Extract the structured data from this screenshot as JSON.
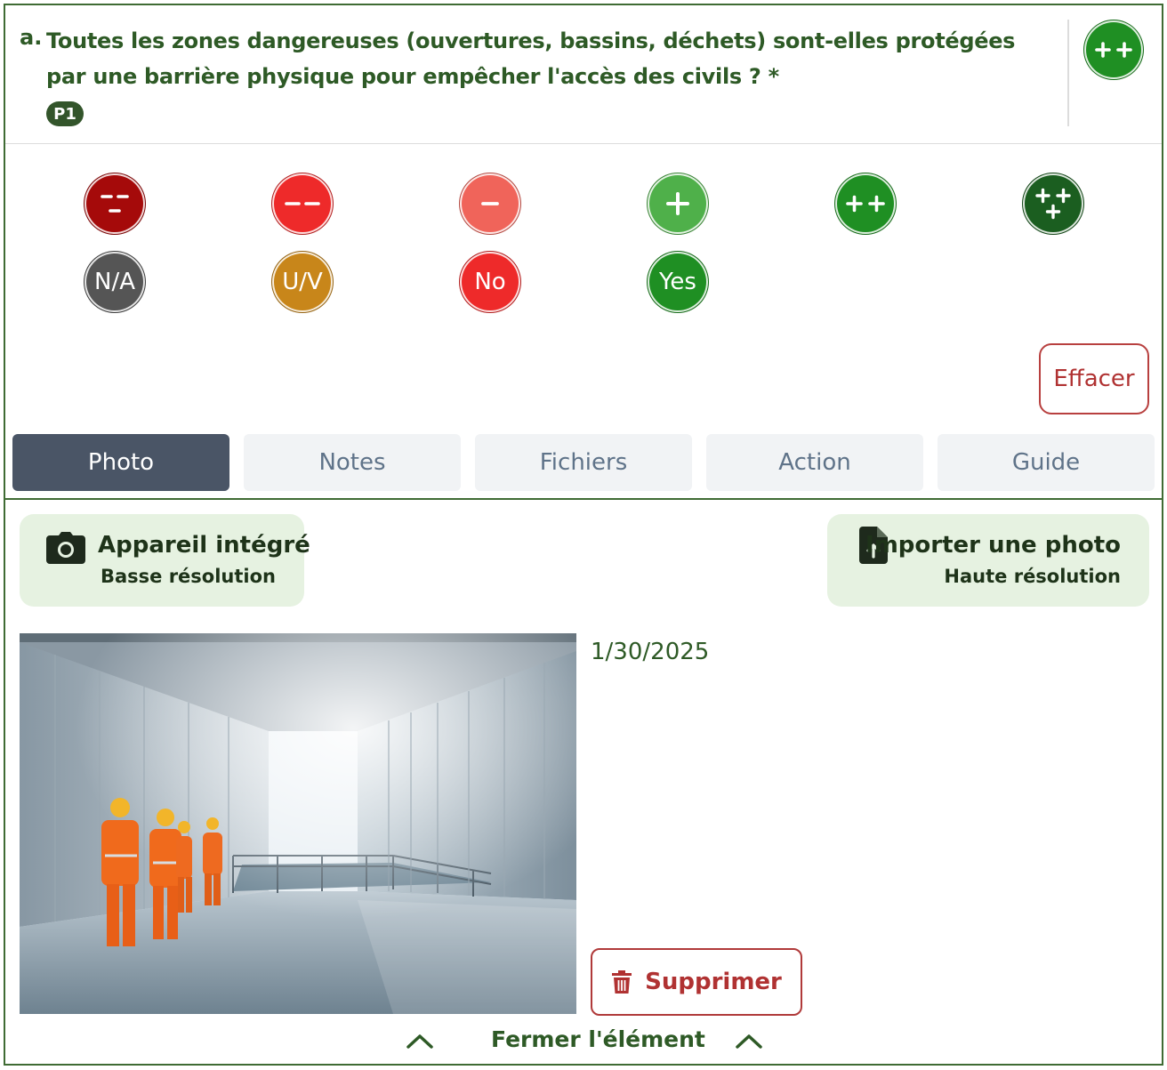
{
  "question": {
    "prefix": "a.",
    "text": "Toutes les zones dangereuses (ouvertures, bassins, déchets) sont-elles protégées par une barrière physique pour empêcher l'accès des civils ? *",
    "priority_badge": "P1",
    "selected_rating_label": "++"
  },
  "ratings": [
    {
      "label": "– – –",
      "color": "#a50a0a"
    },
    {
      "label": "– –",
      "color": "#ee2a2a"
    },
    {
      "label": "–",
      "color": "#f0645a"
    },
    {
      "label": "+",
      "color": "#4fb04a"
    },
    {
      "label": "++",
      "color": "#1f8f23"
    },
    {
      "label": "+++",
      "color": "#1b5e20"
    }
  ],
  "status_options": [
    {
      "label": "N/A",
      "color": "#555555"
    },
    {
      "label": "U/V",
      "color": "#c8861a"
    },
    {
      "label": "No",
      "color": "#ee2a2a"
    },
    {
      "label": "Yes",
      "color": "#1f8f23"
    }
  ],
  "clear_label": "Effacer",
  "tabs": [
    {
      "label": "Photo",
      "active": true
    },
    {
      "label": "Notes",
      "active": false
    },
    {
      "label": "Fichiers",
      "active": false
    },
    {
      "label": "Action",
      "active": false
    },
    {
      "label": "Guide",
      "active": false
    }
  ],
  "photo_actions": {
    "camera": {
      "title": "Appareil intégré",
      "subtitle": "Basse résolution",
      "icon": "camera-icon"
    },
    "upload": {
      "title": "Importer une photo",
      "subtitle": "Haute résolution",
      "icon": "file-upload-icon"
    }
  },
  "photo": {
    "date": "1/30/2025",
    "delete_label": "Supprimer"
  },
  "close_label": "Fermer l'élément",
  "colors": {
    "primary_green": "#2e5a26",
    "tab_active": "#4a5566",
    "danger": "#b03232",
    "action_bg": "#e6f2e1"
  }
}
